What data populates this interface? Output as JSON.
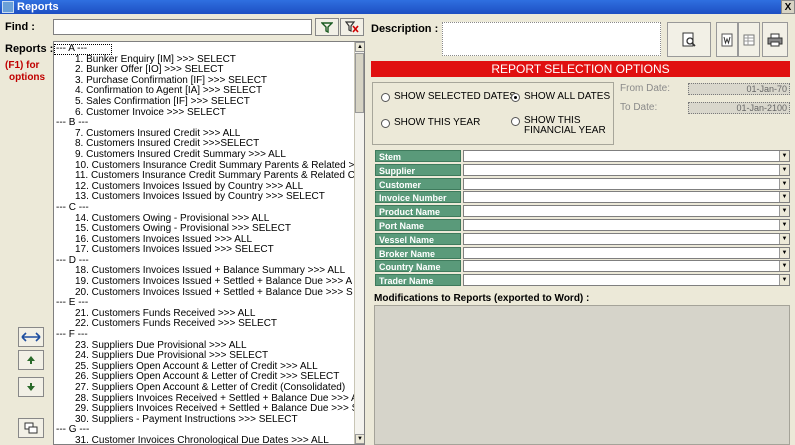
{
  "window": {
    "title": "Reports",
    "close_label": "X"
  },
  "find": {
    "label": "Find :",
    "value": ""
  },
  "reports": {
    "label": "Reports :",
    "hint_line1": "(F1) for",
    "hint_line2": "options",
    "list": [
      {
        "kind": "header",
        "text": "--- A ---"
      },
      {
        "kind": "item",
        "text": "1. Bunker Enquiry [IM] >>> SELECT"
      },
      {
        "kind": "item",
        "text": "2. Bunker Offer [IO] >>> SELECT"
      },
      {
        "kind": "item",
        "text": "3. Purchase Confirmation [IF] >>> SELECT"
      },
      {
        "kind": "item",
        "text": "4. Confirmation to Agent [IA] >>> SELECT"
      },
      {
        "kind": "item",
        "text": "5. Sales Confirmation [IF] >>> SELECT"
      },
      {
        "kind": "item",
        "text": "6. Customer Invoice >>> SELECT"
      },
      {
        "kind": "header",
        "text": "--- B ---"
      },
      {
        "kind": "item",
        "text": "7. Customers Insured Credit >>> ALL"
      },
      {
        "kind": "item",
        "text": "8. Customers Insured Credit >>>SELECT"
      },
      {
        "kind": "item",
        "text": "9. Customers Insured Credit Summary >>> ALL"
      },
      {
        "kind": "item",
        "text": "10. Customers Insurance Credit Summary Parents & Related >>"
      },
      {
        "kind": "item",
        "text": "11. Customers Insurance Credit Summary Parents & Related Co"
      },
      {
        "kind": "item",
        "text": "12. Customers Invoices Issued by Country >>> ALL"
      },
      {
        "kind": "item",
        "text": "13. Customers Invoices Issued by Country >>> SELECT"
      },
      {
        "kind": "header",
        "text": "--- C ---"
      },
      {
        "kind": "item",
        "text": "14. Customers Owing - Provisional >>> ALL"
      },
      {
        "kind": "item",
        "text": "15. Customers Owing - Provisional >>> SELECT"
      },
      {
        "kind": "item",
        "text": "16. Customers Invoices Issued >>> ALL"
      },
      {
        "kind": "item",
        "text": "17. Customers Invoices Issued >>> SELECT"
      },
      {
        "kind": "header",
        "text": "--- D ---"
      },
      {
        "kind": "item",
        "text": "18. Customers Invoices Issued + Balance Summary >>> ALL"
      },
      {
        "kind": "item",
        "text": "19. Customers Invoices Issued + Settled + Balance Due >>> A"
      },
      {
        "kind": "item",
        "text": "20. Customers Invoices Issued + Settled + Balance Due >>> S"
      },
      {
        "kind": "header",
        "text": "--- E ---"
      },
      {
        "kind": "item",
        "text": "21. Customers Funds Received >>> ALL"
      },
      {
        "kind": "item",
        "text": "22. Customers Funds Received >>> SELECT"
      },
      {
        "kind": "header",
        "text": "--- F ---"
      },
      {
        "kind": "item",
        "text": "23. Suppliers Due  Provisional >>> ALL"
      },
      {
        "kind": "item",
        "text": "24. Suppliers Due  Provisional >>> SELECT"
      },
      {
        "kind": "item",
        "text": "25. Suppliers Open Account & Letter of Credit >>> ALL"
      },
      {
        "kind": "item",
        "text": "26. Suppliers Open Account & Letter of Credit >>> SELECT"
      },
      {
        "kind": "item",
        "text": "27. Suppliers Open Account & Letter of Credit (Consolidated)"
      },
      {
        "kind": "item",
        "text": "28. Suppliers Invoices Received + Settled + Balance Due >>> A"
      },
      {
        "kind": "item",
        "text": "29. Suppliers Invoices Received + Settled + Balance Due >>> S"
      },
      {
        "kind": "item",
        "text": "30. Suppliers - Payment Instructions >>> SELECT"
      },
      {
        "kind": "header",
        "text": "--- G ---"
      },
      {
        "kind": "item",
        "text": "31. Customer Invoices  Chronological Due Dates >>> ALL"
      }
    ]
  },
  "description": {
    "label": "Description :",
    "value": ""
  },
  "options": {
    "banner": "REPORT SELECTION OPTIONS",
    "radios": [
      {
        "label": "SHOW SELECTED DATES",
        "checked": false
      },
      {
        "label": "SHOW ALL DATES",
        "checked": true
      },
      {
        "label": "SHOW THIS YEAR",
        "checked": false
      },
      {
        "label_line1": "SHOW THIS",
        "label_line2": "FINANCIAL YEAR",
        "checked": false
      }
    ],
    "from_date": {
      "label": "From Date:",
      "value": "01-Jan-70"
    },
    "to_date": {
      "label": "To Date:",
      "value": "01-Jan-2100"
    }
  },
  "filters": [
    {
      "label": "Stem",
      "value": ""
    },
    {
      "label": "Supplier",
      "value": ""
    },
    {
      "label": "Customer",
      "value": ""
    },
    {
      "label": "Invoice Number",
      "value": ""
    },
    {
      "label": "Product Name",
      "value": ""
    },
    {
      "label": "Port Name",
      "value": ""
    },
    {
      "label": "Vessel Name",
      "value": ""
    },
    {
      "label": "Broker Name",
      "value": ""
    },
    {
      "label": "Country Name",
      "value": ""
    },
    {
      "label": "Trader Name",
      "value": ""
    }
  ],
  "modifications": {
    "label": "Modifications to Reports (exported to Word) :",
    "value": ""
  },
  "icons": {
    "filter": "funnel-icon",
    "clear_filter": "funnel-clear-icon",
    "preview": "print-preview-icon",
    "word": "word-export-icon",
    "excel": "spreadsheet-icon",
    "print": "printer-icon",
    "expand": "expand-horizontal-icon",
    "up": "arrow-up-icon",
    "down": "arrow-down-icon",
    "windows": "windows-icon"
  },
  "colors": {
    "banner": "#e01010",
    "filter_label": "#5a9a7a",
    "title_bar": "#2f6fe0",
    "hint": "#c00000"
  }
}
